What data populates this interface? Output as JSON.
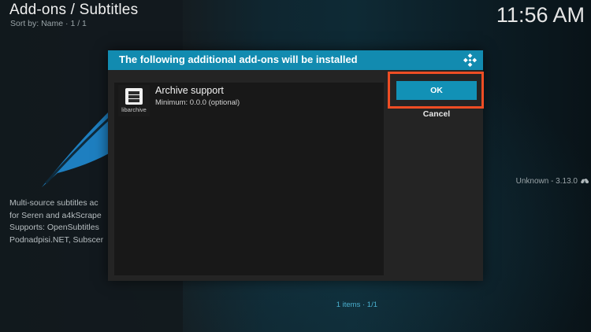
{
  "header": {
    "title": "Add-ons / Subtitles",
    "sort_text": "Sort by: Name · 1 / 1",
    "clock": "11:56 AM"
  },
  "background": {
    "description_lines": [
      "Multi-source subtitles ac",
      "for Seren and a4kScrape",
      "Supports: OpenSubtitles",
      "Podnadpisi.NET, Subscer"
    ],
    "version": "Unknown - 3.13.0",
    "version_icon": "cloud-download-icon"
  },
  "dialog": {
    "title": "The following additional add-ons will be installed",
    "logo": "kodi-logo-icon",
    "items": [
      {
        "name": "Archive support",
        "sub": "Minimum: 0.0.0 (optional)",
        "thumb_label": "libarchive",
        "thumb_icon": "archive-box-icon"
      }
    ],
    "items_count": "1 items",
    "page_indicator": "1/1",
    "ok_label": "OK",
    "cancel_label": "Cancel"
  },
  "colors": {
    "accent": "#1291b6",
    "highlight": "#ee4d24",
    "dialog_bg": "#242424"
  }
}
